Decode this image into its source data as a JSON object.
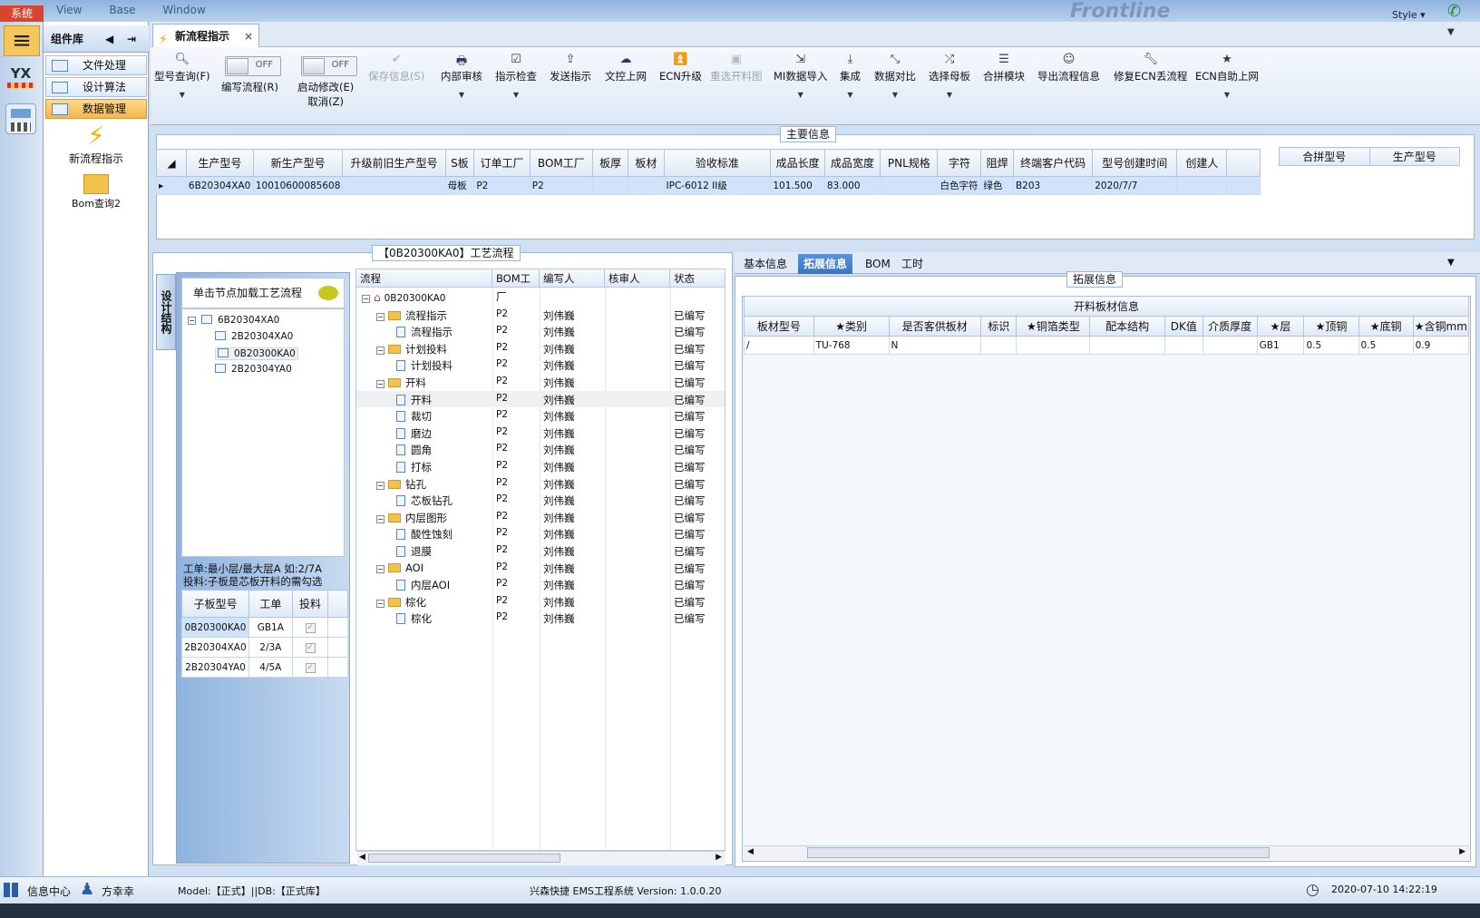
{
  "topbar": {
    "system": "系统",
    "menus": [
      "View",
      "Base",
      "Window"
    ],
    "brand": "Frontline",
    "style": "Style"
  },
  "sidebar": {
    "header": "组件库",
    "rail_app": "YX",
    "items": [
      {
        "label": "文件处理"
      },
      {
        "label": "设计算法"
      },
      {
        "label": "数据管理",
        "active": true
      }
    ],
    "big_icons": [
      {
        "label": "新流程指示"
      },
      {
        "label": "Bom查询2"
      }
    ]
  },
  "tab": {
    "title": "新流程指示"
  },
  "toolbar": {
    "type_query": "型号查询(F)",
    "write_flow": "编写流程(R)",
    "write_flow_toggle": "OFF",
    "start_edit": "启动修改(E)",
    "start_edit_sub": "取消(Z)",
    "start_edit_toggle": "OFF",
    "save_info": "保存信息(S)",
    "buttons": [
      "内部审核",
      "指示检查",
      "发送指示",
      "文控上网",
      "ECN升级",
      "重选开料图",
      "MI数据导入",
      "集成",
      "数据对比",
      "选择母板",
      "合拼模块",
      "导出流程信息",
      "修复ECN丢流程",
      "ECN自助上网"
    ]
  },
  "main_info": {
    "legend": "主要信息",
    "columns": [
      "生产型号",
      "新生产型号",
      "升级前旧生产型号",
      "S板",
      "订单工厂",
      "BOM工厂",
      "板厚",
      "板材",
      "验收标准",
      "成品长度",
      "成品宽度",
      "PNL规格",
      "字符",
      "阻焊",
      "终端客户代码",
      "型号创建时间",
      "创建人"
    ],
    "row": [
      "6B20304XA0",
      "10010600085608",
      "",
      "母板",
      "P2",
      "P2",
      "",
      "",
      "IPC-6012 II级",
      "101.500",
      "83.000",
      "",
      "白色字符",
      "绿色",
      "B203",
      "2020/7/7",
      ""
    ],
    "side_columns": [
      "合拼型号",
      "生产型号"
    ]
  },
  "process": {
    "legend": "【0B20300KA0】工艺流程",
    "vtab": "设计结构",
    "click_hint": "单击节点加载工艺流程",
    "tree": [
      {
        "label": "6B20304XA0",
        "level": 0
      },
      {
        "label": "2B20304XA0",
        "level": 1
      },
      {
        "label": "0B20300KA0",
        "level": 1,
        "selected": true
      },
      {
        "label": "2B20304YA0",
        "level": 1
      }
    ],
    "note1": "工单:最小层/最大层A 如:2/7A",
    "note2": "投料:子板是芯板开料的需勾选",
    "sub_columns": [
      "子板型号",
      "工单",
      "投料"
    ],
    "sub_rows": [
      [
        "0B20300KA0",
        "GB1A"
      ],
      [
        "2B20304XA0",
        "2/3A"
      ],
      [
        "2B20304YA0",
        "4/5A"
      ]
    ],
    "flow_columns": [
      "流程",
      "BOM工厂",
      "编写人",
      "核审人",
      "状态"
    ],
    "flow_root": "0B20300KA0",
    "flow_rows": [
      {
        "name": "流程指示",
        "type": "folder"
      },
      {
        "name": "流程指示",
        "type": "item"
      },
      {
        "name": "计划投料",
        "type": "folder"
      },
      {
        "name": "计划投料",
        "type": "item"
      },
      {
        "name": "开料",
        "type": "folder"
      },
      {
        "name": "开料",
        "type": "item",
        "hl": true
      },
      {
        "name": "裁切",
        "type": "item"
      },
      {
        "name": "磨边",
        "type": "item"
      },
      {
        "name": "圆角",
        "type": "item"
      },
      {
        "name": "打标",
        "type": "item"
      },
      {
        "name": "钻孔",
        "type": "folder"
      },
      {
        "name": "芯板钻孔",
        "type": "item"
      },
      {
        "name": "内层图形",
        "type": "folder"
      },
      {
        "name": "酸性蚀刻",
        "type": "item"
      },
      {
        "name": "退膜",
        "type": "item"
      },
      {
        "name": "AOI",
        "type": "folder"
      },
      {
        "name": "内层AOI",
        "type": "item"
      },
      {
        "name": "棕化",
        "type": "folder"
      },
      {
        "name": "棕化",
        "type": "item"
      }
    ],
    "factory": "P2",
    "writer": "刘伟巍",
    "status": "已编写"
  },
  "right": {
    "tabs": [
      "基本信息",
      "拓展信息",
      "BOM",
      "工时"
    ],
    "legend": "拓展信息",
    "table_title": "开料板材信息",
    "columns": [
      "板材型号",
      "★类别",
      "是否客供板材",
      "标识",
      "★铜箔类型",
      "配本结构",
      "DK值",
      "介质厚度",
      "★层",
      "★顶铜",
      "★底铜",
      "★含铜mm"
    ],
    "row": [
      "/",
      "TU-768",
      "N",
      "",
      "",
      "",
      "",
      "",
      "GB1",
      "0.5",
      "0.5",
      "0.9"
    ]
  },
  "status": {
    "info_center": "信息中心",
    "user": "方幸幸",
    "model_db": "Model:【正式】||DB:【正式库】",
    "system": "兴森快捷 EMS工程系统 Version: 1.0.0.20",
    "datetime": "2020-07-10 14:22:19"
  },
  "colors": {
    "accent": "#3a74c3",
    "active_item": "#f6b54a",
    "selection": "#cfe3fa"
  }
}
